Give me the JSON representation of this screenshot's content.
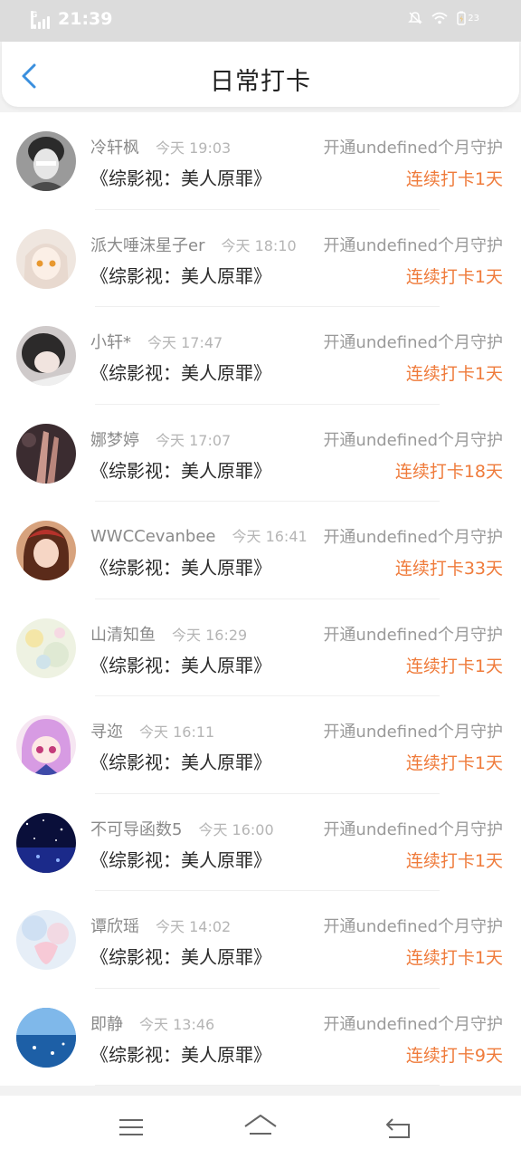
{
  "status_bar": {
    "time": "21:39",
    "network": "G",
    "battery": "23",
    "icons": [
      "signal-icon",
      "mute-icon",
      "wifi-icon",
      "battery-icon"
    ]
  },
  "header": {
    "title": "日常打卡",
    "back_icon": "chevron-left-icon"
  },
  "colors": {
    "accent": "#3a8fde",
    "streak": "#ef7b3b",
    "name": "#8a8a8a",
    "time": "#b5b5b5"
  },
  "entries": [
    {
      "name": "冷轩枫",
      "time": "今天 19:03",
      "guard": "开通undefined个月守护",
      "show": "《综影视：美人原罪》",
      "streak": "连续打卡1天"
    },
    {
      "name": "派大唾沫星子er",
      "time": "今天 18:10",
      "guard": "开通undefined个月守护",
      "show": "《综影视：美人原罪》",
      "streak": "连续打卡1天"
    },
    {
      "name": "小轩*",
      "time": "今天 17:47",
      "guard": "开通undefined个月守护",
      "show": "《综影视：美人原罪》",
      "streak": "连续打卡1天"
    },
    {
      "name": "娜梦婷",
      "time": "今天 17:07",
      "guard": "开通undefined个月守护",
      "show": "《综影视：美人原罪》",
      "streak": "连续打卡18天"
    },
    {
      "name": "WWCCevanbee",
      "time": "今天 16:41",
      "guard": "开通undefined个月守护",
      "show": "《综影视：美人原罪》",
      "streak": "连续打卡33天"
    },
    {
      "name": "山清知鱼",
      "time": "今天 16:29",
      "guard": "开通undefined个月守护",
      "show": "《综影视：美人原罪》",
      "streak": "连续打卡1天"
    },
    {
      "name": "寻迩",
      "time": "今天 16:11",
      "guard": "开通undefined个月守护",
      "show": "《综影视：美人原罪》",
      "streak": "连续打卡1天"
    },
    {
      "name": "不可导函数5",
      "time": "今天 16:00",
      "guard": "开通undefined个月守护",
      "show": "《综影视：美人原罪》",
      "streak": "连续打卡1天"
    },
    {
      "name": "谭欣瑶",
      "time": "今天 14:02",
      "guard": "开通undefined个月守护",
      "show": "《综影视：美人原罪》",
      "streak": "连续打卡1天"
    },
    {
      "name": "即静",
      "time": "今天 13:46",
      "guard": "开通undefined个月守护",
      "show": "《综影视：美人原罪》",
      "streak": "连续打卡9天"
    }
  ],
  "navbar": {
    "icons": [
      "menu-icon",
      "home-icon",
      "back-icon"
    ]
  }
}
